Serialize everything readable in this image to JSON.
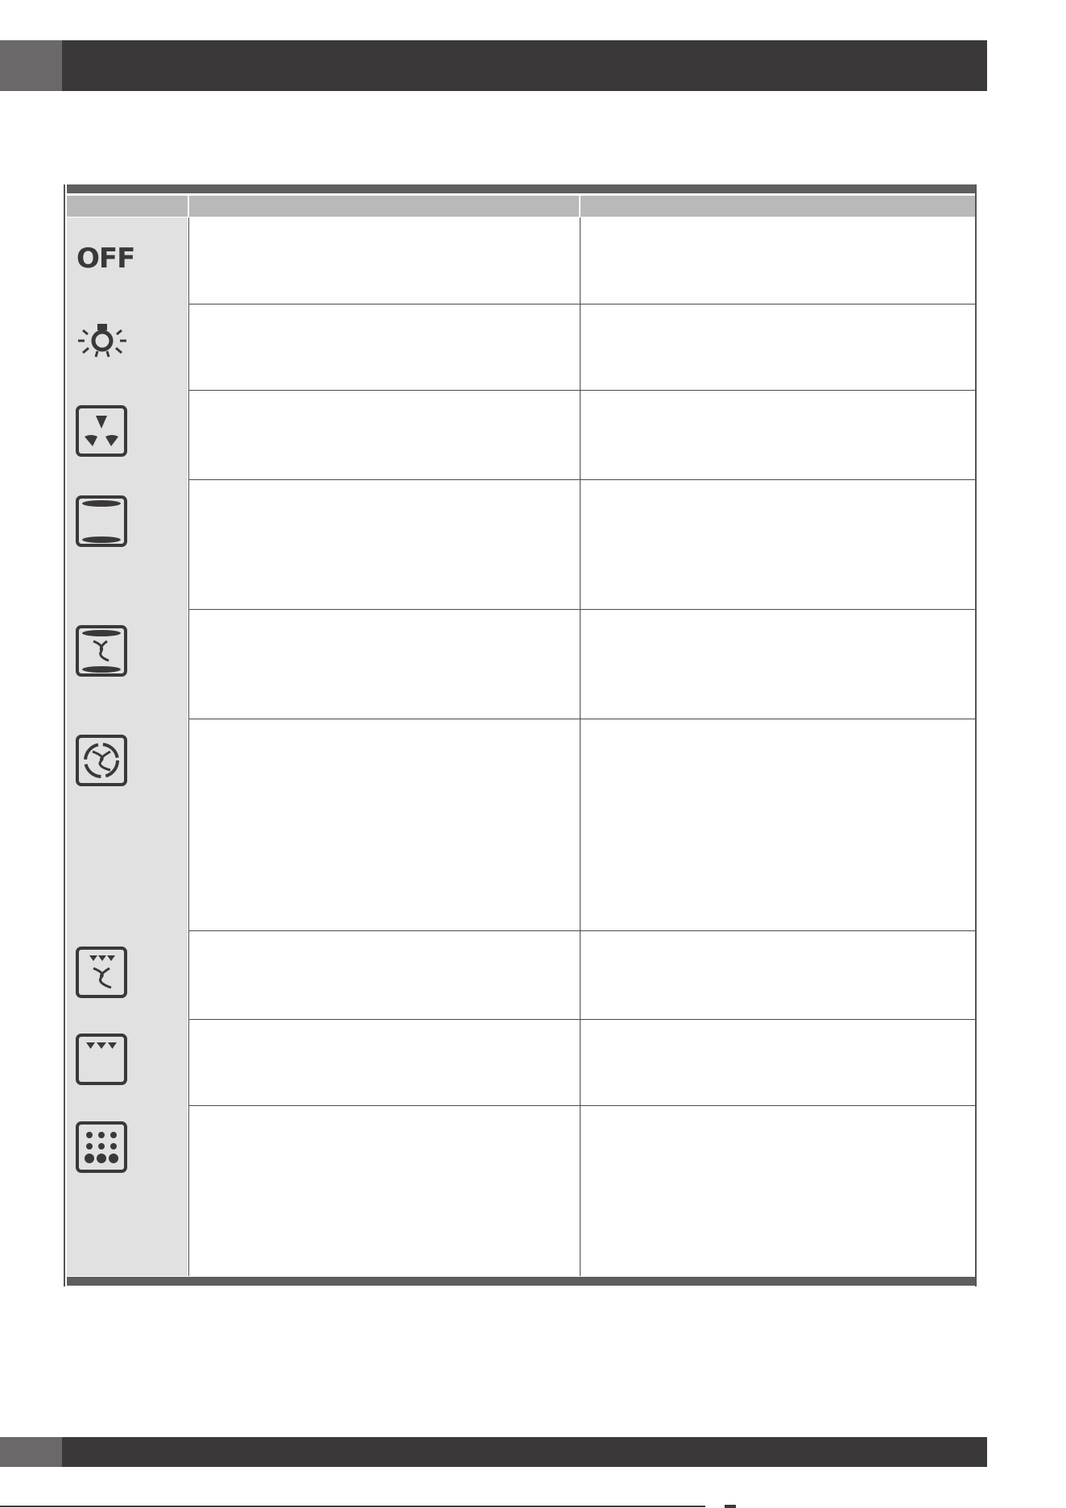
{
  "header": {
    "title": ""
  },
  "table": {
    "columns": [
      "",
      "",
      ""
    ],
    "rows": [
      {
        "icon": "off-text-icon",
        "label": "OFF",
        "description": "",
        "notes": ""
      },
      {
        "icon": "lamp-icon",
        "description": "",
        "notes": ""
      },
      {
        "icon": "defrost-fan-icon",
        "description": "",
        "notes": ""
      },
      {
        "icon": "top-bottom-heating-icon",
        "description": "",
        "notes": ""
      },
      {
        "icon": "fan-top-bottom-icon",
        "description": "",
        "notes": ""
      },
      {
        "icon": "fan-ring-heating-icon",
        "description": "",
        "notes": ""
      },
      {
        "icon": "grill-fan-icon",
        "description": "",
        "notes": ""
      },
      {
        "icon": "grill-icon",
        "description": "",
        "notes": ""
      },
      {
        "icon": "pizza-function-icon",
        "description": "",
        "notes": ""
      }
    ]
  },
  "colors": {
    "header_bar": "#3b3839",
    "header_tab": "#6a6868",
    "table_border": "#5f5d5d",
    "column_header": "#b9b9b9",
    "icon_column": "#e1e1e1"
  }
}
